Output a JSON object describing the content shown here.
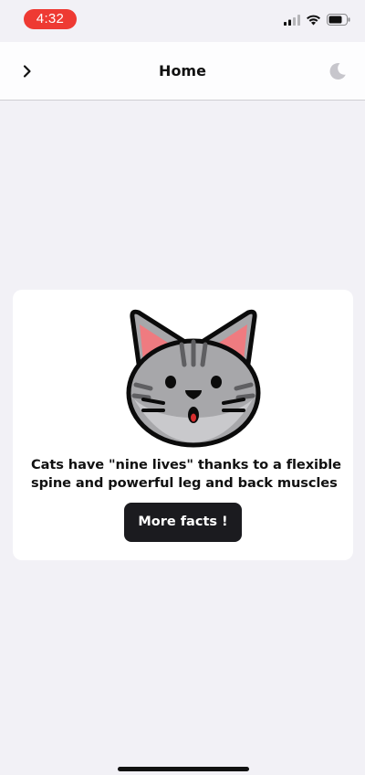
{
  "status_bar": {
    "time": "4:32",
    "time_pill_color": "#ee3a33",
    "icons": [
      "cellular-signal-icon",
      "wifi-icon",
      "battery-icon"
    ]
  },
  "nav": {
    "title": "Home",
    "back_icon": "chevron-right-icon",
    "theme_icon": "moon-icon"
  },
  "fact_card": {
    "image": "cat-face-illustration",
    "fact": "Cats have \"nine lives\" thanks to a flexible spine and powerful leg and back muscles",
    "button_label": "More facts !"
  },
  "colors": {
    "background": "#f2f1f6",
    "card": "#ffffff",
    "button": "#1b1b1f"
  }
}
